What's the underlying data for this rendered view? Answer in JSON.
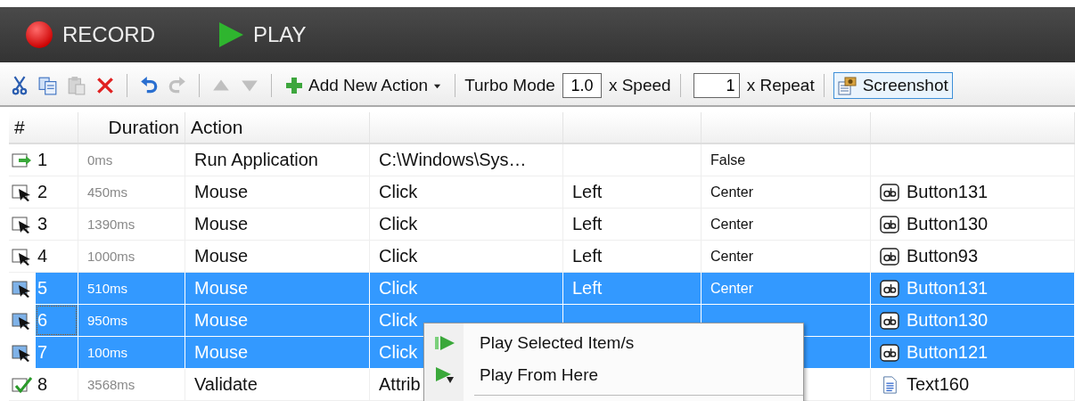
{
  "topbar": {
    "record": {
      "label": "RECORD"
    },
    "play": {
      "label": "PLAY"
    }
  },
  "toolbar": {
    "tools": [
      {
        "kind": "cut",
        "disabled": false
      },
      {
        "kind": "copy",
        "disabled": false
      },
      {
        "kind": "paste",
        "disabled": true
      },
      {
        "kind": "delete",
        "disabled": false
      },
      {
        "kind": "sep"
      },
      {
        "kind": "undo",
        "disabled": false
      },
      {
        "kind": "redo",
        "disabled": true
      },
      {
        "kind": "sep"
      },
      {
        "kind": "up",
        "disabled": true
      },
      {
        "kind": "down",
        "disabled": true
      },
      {
        "kind": "sep"
      }
    ],
    "add_action": {
      "label": "Add New Action"
    },
    "turbo_label": "Turbo Mode",
    "speed": {
      "value": "1.0",
      "suffix": "x Speed"
    },
    "repeat": {
      "value": "1",
      "suffix": "x Repeat"
    },
    "screenshot": {
      "label": "Screenshot",
      "highlighted": true
    }
  },
  "table": {
    "columns": [
      "#",
      "Duration",
      "Action"
    ],
    "rows": [
      {
        "kind": "run",
        "number": "1",
        "duration": "0ms",
        "action": "Run Application",
        "column_4": "C:\\Windows\\Sys…",
        "column_6": "False",
        "selected": false,
        "focused": false
      },
      {
        "kind": "mouse",
        "number": "2",
        "duration": "450ms",
        "action": "Mouse",
        "column_4": "Click",
        "column_5": "Left",
        "column_6": "Center",
        "column_7": {
          "kind": "button",
          "text": "Button131"
        },
        "selected": false,
        "focused": false
      },
      {
        "kind": "mouse",
        "number": "3",
        "duration": "1390ms",
        "action": "Mouse",
        "column_4": "Click",
        "column_5": "Left",
        "column_6": "Center",
        "column_7": {
          "kind": "button",
          "text": "Button130"
        },
        "selected": false,
        "focused": false
      },
      {
        "kind": "mouse",
        "number": "4",
        "duration": "1000ms",
        "action": "Mouse",
        "column_4": "Click",
        "column_5": "Left",
        "column_6": "Center",
        "column_7": {
          "kind": "button",
          "text": "Button93"
        },
        "selected": false,
        "focused": false
      },
      {
        "kind": "mouse",
        "number": "5",
        "duration": "510ms",
        "action": "Mouse",
        "column_4": "Click",
        "column_5": "Left",
        "column_6": "Center",
        "column_7": {
          "kind": "button",
          "text": "Button131"
        },
        "selected": true,
        "focused": false
      },
      {
        "kind": "mouse",
        "number": "6",
        "duration": "950ms",
        "action": "Mouse",
        "column_4": "Click",
        "column_7": {
          "kind": "button",
          "text": "Button130"
        },
        "selected": true,
        "focused": true
      },
      {
        "kind": "mouse",
        "number": "7",
        "duration": "100ms",
        "action": "Mouse",
        "column_4": "Click",
        "column_7": {
          "kind": "button",
          "text": "Button121"
        },
        "selected": true,
        "focused": false
      },
      {
        "kind": "validate",
        "number": "8",
        "duration": "3568ms",
        "action": "Validate",
        "column_4": "Attrib",
        "column_7": {
          "kind": "text",
          "text": "Text160"
        },
        "selected": false,
        "focused": false
      }
    ]
  },
  "context_menu": {
    "items": [
      {
        "kind": "play-selected",
        "label": "Play Selected Item/s"
      },
      {
        "kind": "play-from",
        "label": "Play From Here"
      }
    ]
  }
}
